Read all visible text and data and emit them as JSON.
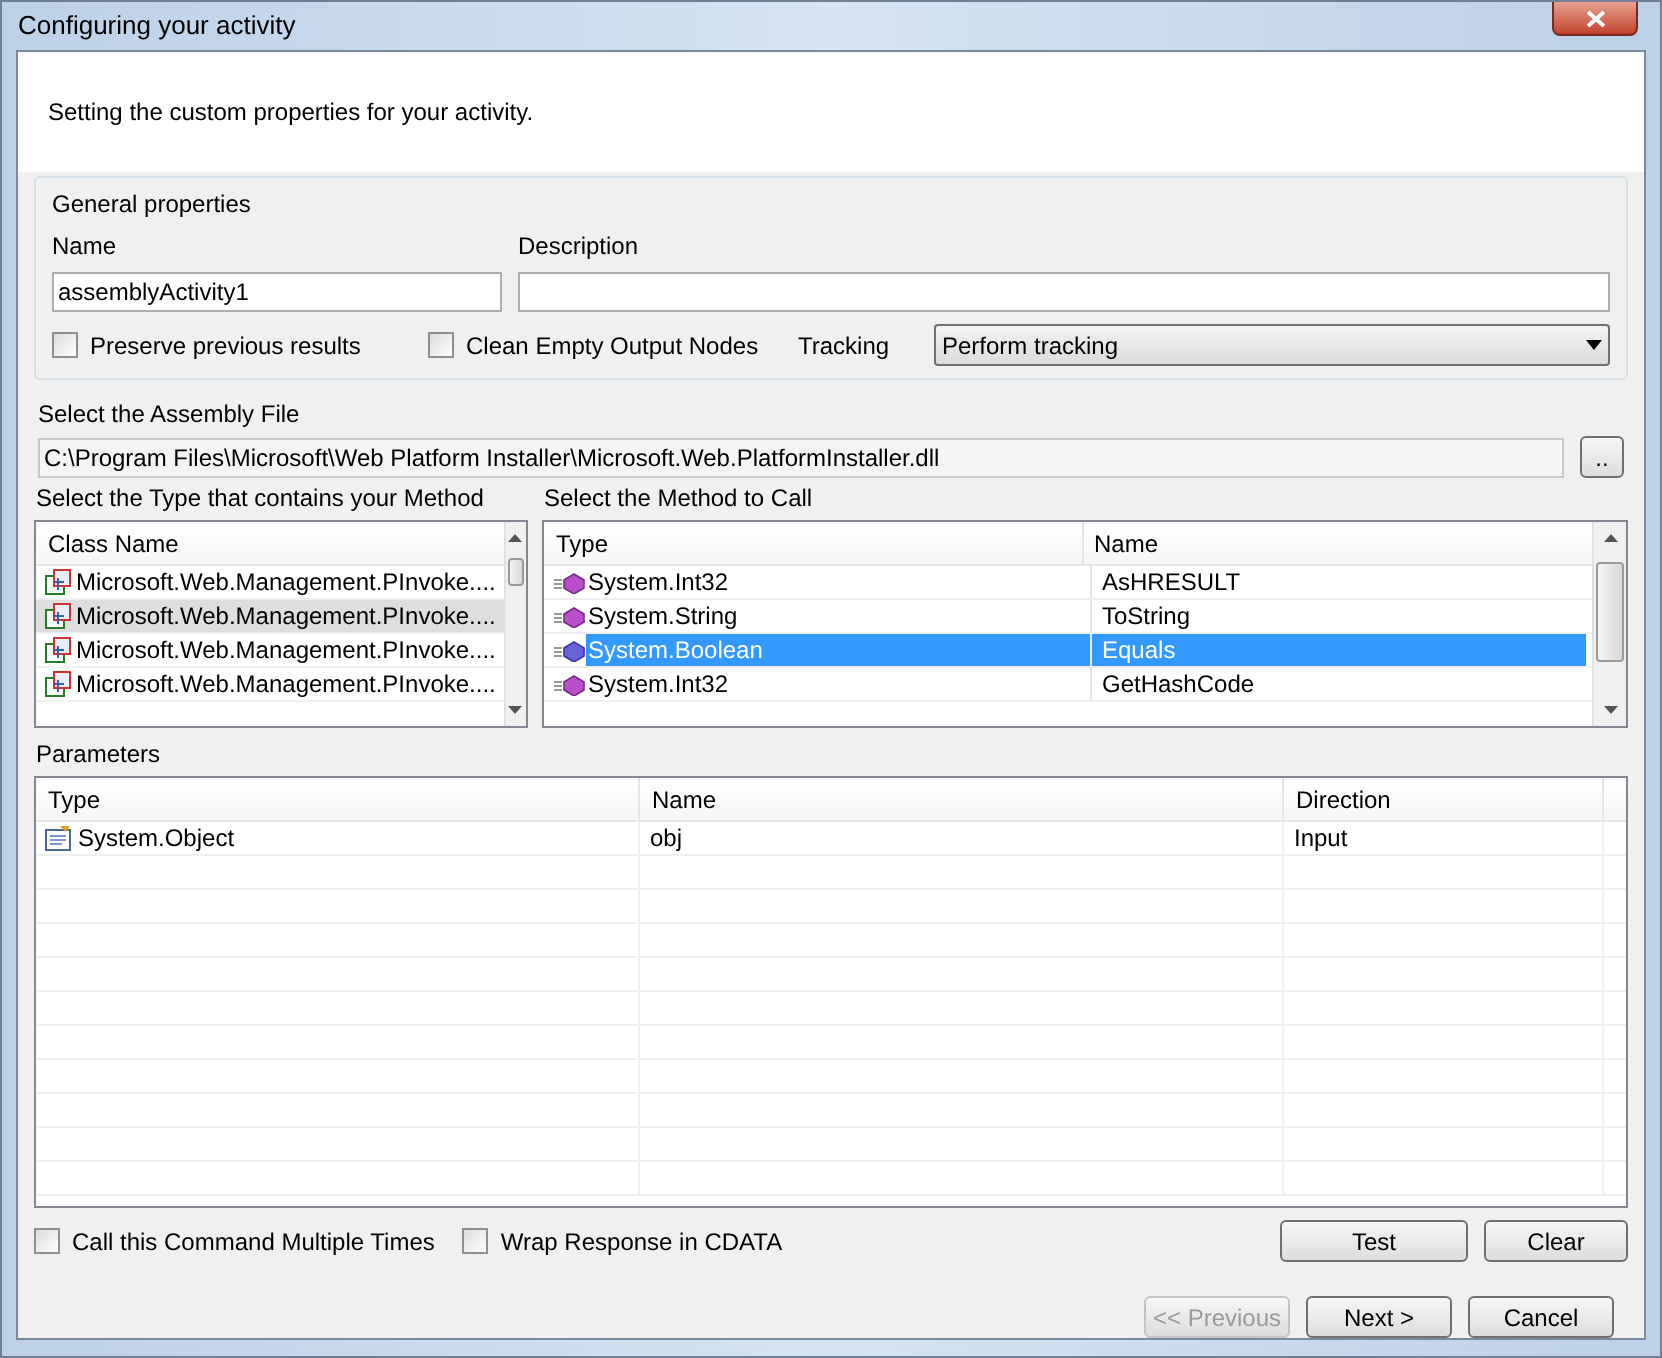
{
  "window": {
    "title": "Configuring your activity"
  },
  "header": {
    "text": "Setting the custom properties for your activity."
  },
  "general": {
    "title": "General properties",
    "name_label": "Name",
    "name_value": "assemblyActivity1",
    "description_label": "Description",
    "options": [
      {
        "label": "Preserve previous results",
        "checked": false
      },
      {
        "label": "Clean Empty Output Nodes",
        "checked": false
      }
    ],
    "tracking_label": "Tracking",
    "tracking_value": "Perform tracking"
  },
  "assembly": {
    "label": "Select the Assembly File",
    "path": "C:\\Program Files\\Microsoft\\Web Platform Installer\\Microsoft.Web.PlatformInstaller.dll",
    "browse": ".."
  },
  "types": {
    "label": "Select the Type that contains your Method",
    "column": "Class Name",
    "rows": [
      {
        "name": "Microsoft.Web.Management.PInvoke....",
        "selected": false
      },
      {
        "name": "Microsoft.Web.Management.PInvoke....",
        "selected": true
      },
      {
        "name": "Microsoft.Web.Management.PInvoke....",
        "selected": false
      },
      {
        "name": "Microsoft.Web.Management.PInvoke....",
        "selected": false
      }
    ]
  },
  "methods": {
    "label": "Select the Method to Call",
    "columns": [
      "Type",
      "Name"
    ],
    "rows": [
      {
        "type": "System.Int32",
        "name": "AsHRESULT",
        "selected": false
      },
      {
        "type": "System.String",
        "name": "ToString",
        "selected": false
      },
      {
        "type": "System.Boolean",
        "name": "Equals",
        "selected": true
      },
      {
        "type": "System.Int32",
        "name": "GetHashCode",
        "selected": false
      }
    ]
  },
  "parameters": {
    "label": "Parameters",
    "columns": [
      "Type",
      "Name",
      "Direction"
    ],
    "rows": [
      {
        "type": "System.Object",
        "name": "obj",
        "direction": "Input"
      }
    ]
  },
  "bottom_options": [
    {
      "label": "Call this Command Multiple Times",
      "checked": false
    },
    {
      "label": "Wrap Response in CDATA",
      "checked": false
    }
  ],
  "actions": [
    {
      "label": "Test"
    },
    {
      "label": "Clear"
    }
  ],
  "nav": [
    {
      "label": "<< Previous",
      "disabled": true
    },
    {
      "label": "Next >",
      "disabled": false
    },
    {
      "label": "Cancel",
      "disabled": false
    }
  ]
}
